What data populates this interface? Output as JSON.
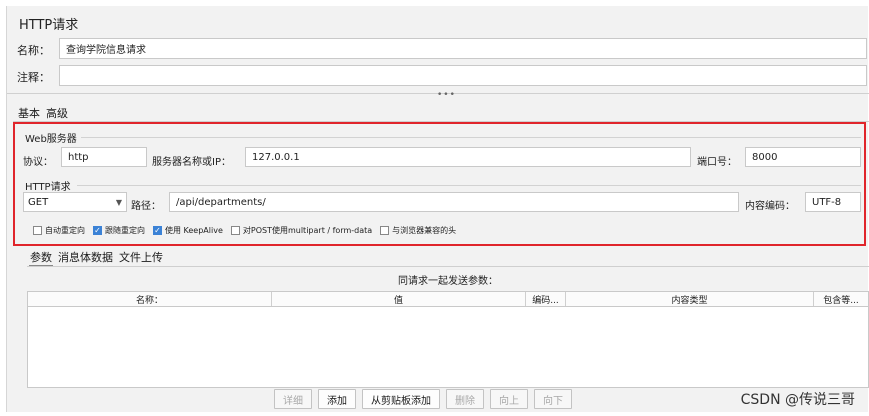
{
  "panel": {
    "title": "HTTP请求"
  },
  "name_row": {
    "label": "名称：",
    "value": "查询学院信息请求"
  },
  "comment_row": {
    "label": "注释：",
    "value": ""
  },
  "splitter": {
    "dots": "•••"
  },
  "top_tabs": [
    {
      "label": "基本"
    },
    {
      "label": "高级"
    }
  ],
  "web_server": {
    "group_label": "Web服务器",
    "protocol_label": "协议：",
    "protocol_value": "http",
    "server_label": "服务器名称或IP：",
    "server_value": "127.0.0.1",
    "port_label": "端口号：",
    "port_value": "8000"
  },
  "http_request": {
    "group_label": "HTTP请求",
    "method_value": "GET",
    "path_label": "路径：",
    "path_value": "/api/departments/",
    "encoding_label": "内容编码：",
    "encoding_value": "UTF-8"
  },
  "options": [
    {
      "label": "自动重定向",
      "checked": false
    },
    {
      "label": "跟随重定向",
      "checked": true
    },
    {
      "label": "使用 KeepAlive",
      "checked": true
    },
    {
      "label": "对POST使用multipart / form-data",
      "checked": false
    },
    {
      "label": "与浏览器兼容的头",
      "checked": false
    }
  ],
  "bottom_tabs": [
    {
      "label": "参数"
    },
    {
      "label": "消息体数据"
    },
    {
      "label": "文件上传"
    }
  ],
  "params": {
    "title": "同请求一起发送参数：",
    "columns": [
      "名称：",
      "值",
      "编码...",
      "内容类型",
      "包含等..."
    ]
  },
  "buttons": [
    {
      "label": "详细",
      "enabled": false
    },
    {
      "label": "添加",
      "enabled": true
    },
    {
      "label": "从剪贴板添加",
      "enabled": true
    },
    {
      "label": "删除",
      "enabled": false
    },
    {
      "label": "向上",
      "enabled": false
    },
    {
      "label": "向下",
      "enabled": false
    }
  ],
  "watermark": "CSDN @传说三哥",
  "colors": {
    "highlight_border": "#e0252b",
    "checkbox_on": "#3b82d6"
  }
}
